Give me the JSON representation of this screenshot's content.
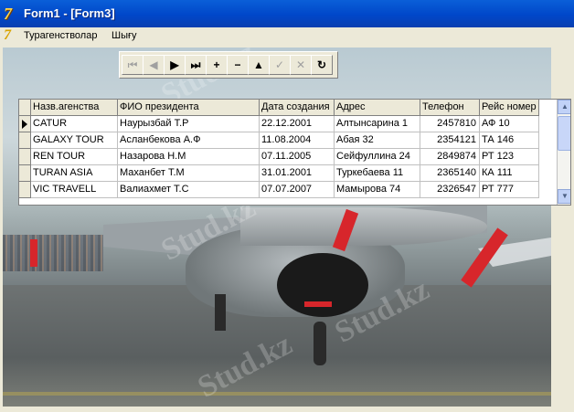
{
  "window": {
    "title": "Form1 - [Form3]"
  },
  "menu": {
    "items": [
      "Турагенстволар",
      "Шығу"
    ]
  },
  "navigator": {
    "buttons": [
      {
        "name": "first",
        "glyph": "⏮",
        "enabled": false
      },
      {
        "name": "prior",
        "glyph": "◀",
        "enabled": false
      },
      {
        "name": "next",
        "glyph": "▶",
        "enabled": true
      },
      {
        "name": "last",
        "glyph": "⏭",
        "enabled": true
      },
      {
        "name": "insert",
        "glyph": "+",
        "enabled": true
      },
      {
        "name": "delete",
        "glyph": "−",
        "enabled": true
      },
      {
        "name": "edit",
        "glyph": "▲",
        "enabled": true
      },
      {
        "name": "post",
        "glyph": "✓",
        "enabled": false
      },
      {
        "name": "cancel",
        "glyph": "✕",
        "enabled": false
      },
      {
        "name": "refresh",
        "glyph": "↻",
        "enabled": true
      }
    ]
  },
  "grid": {
    "columns": [
      "Назв.агенства",
      "ФИО президента",
      "Дата создания",
      "Адрес",
      "Телефон",
      "Рейс номер"
    ],
    "rows": [
      [
        "CATUR",
        "Наурызбай Т.Р",
        "22.12.2001",
        "Алтынсарина 1",
        "2457810",
        "АФ 10"
      ],
      [
        "GALAXY TOUR",
        "Асланбекова А.Ф",
        "11.08.2004",
        "Абая 32",
        "2354121",
        "ТА 146"
      ],
      [
        "REN TOUR",
        "Назарова Н.М",
        "07.11.2005",
        "Сейфуллина 24",
        "2849874",
        "РТ 123"
      ],
      [
        "TURAN ASIA",
        "Маханбет Т.М",
        "31.01.2001",
        "Туркебаева 11",
        "2365140",
        "КА 111"
      ],
      [
        "VIC TRAVELL",
        "Валиахмет Т.С",
        "07.07.2007",
        "Мамырова 74",
        "2326547",
        "РТ 777"
      ]
    ]
  },
  "colors": {
    "titlebar": "#0047c9",
    "face": "#ece9d8",
    "alert": "#d7262b"
  }
}
